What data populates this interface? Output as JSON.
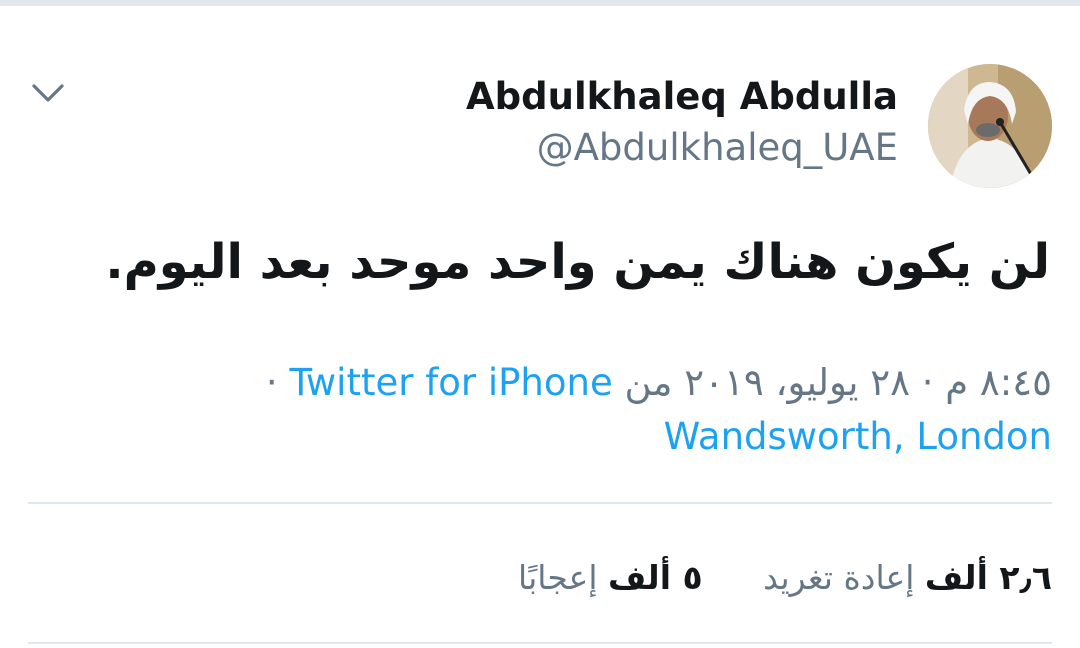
{
  "tweet": {
    "author": {
      "display_name": "Abdulkhaleq Abdulla",
      "handle": "@Abdulkhaleq_UAE"
    },
    "text": "لن يكون هناك يمن واحد موحد بعد اليوم.",
    "meta": {
      "timestamp": "٨:٤٥ م · ٢٨ يوليو، ٢٠١٩",
      "from": "من",
      "location": "Wandsworth, London",
      "separator": "·",
      "source": "Twitter for iPhone"
    },
    "stats": {
      "retweets_count": "٢٫٦ ألف",
      "retweets_label": "إعادة تغريد",
      "likes_count": "٥ ألف",
      "likes_label": "إعجابًا"
    }
  },
  "colors": {
    "text_primary": "#14171a",
    "text_secondary": "#657786",
    "link": "#1da1f2",
    "divider": "#e1e8ed"
  }
}
